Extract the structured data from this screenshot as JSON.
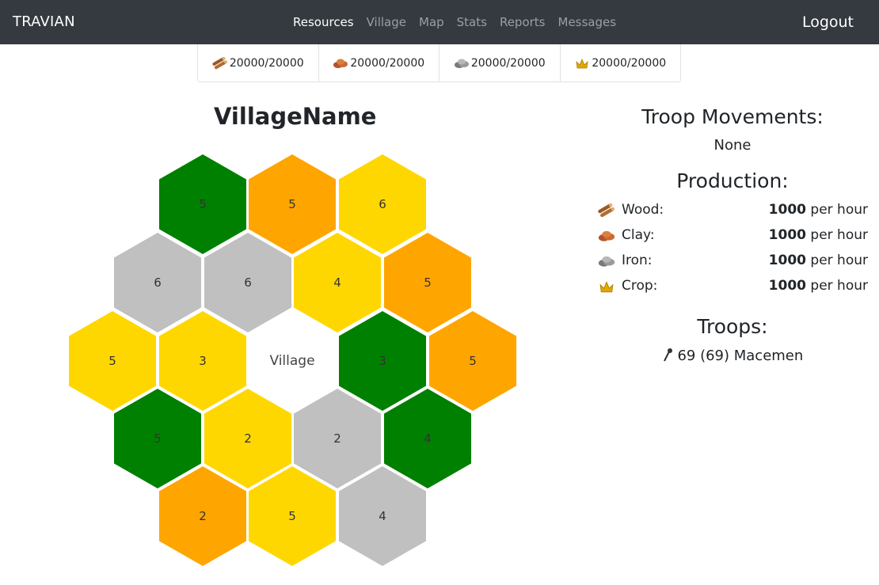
{
  "nav": {
    "brand": "TRAVIAN",
    "links": [
      "Resources",
      "Village",
      "Map",
      "Stats",
      "Reports",
      "Messages"
    ],
    "active": "Resources",
    "logout": "Logout"
  },
  "resources": [
    {
      "icon": "wood-icon",
      "value": "20000/20000"
    },
    {
      "icon": "clay-icon",
      "value": "20000/20000"
    },
    {
      "icon": "iron-icon",
      "value": "20000/20000"
    },
    {
      "icon": "crop-icon",
      "value": "20000/20000"
    }
  ],
  "village": {
    "name": "VillageName",
    "center_label": "Village",
    "fields": [
      {
        "color": "#008000",
        "level": "5"
      },
      {
        "color": "#FFA500",
        "level": "5"
      },
      {
        "color": "#FFD700",
        "level": "6"
      },
      {
        "color": "#C0C0C0",
        "level": "6"
      },
      {
        "color": "#C0C0C0",
        "level": "6"
      },
      {
        "color": "#FFD700",
        "level": "4"
      },
      {
        "color": "#FFA500",
        "level": "5"
      },
      {
        "color": "#FFD700",
        "level": "5"
      },
      {
        "color": "#FFD700",
        "level": "3"
      },
      {
        "color": "#008000",
        "level": "3"
      },
      {
        "color": "#FFA500",
        "level": "5"
      },
      {
        "color": "#008000",
        "level": "5"
      },
      {
        "color": "#FFD700",
        "level": "2"
      },
      {
        "color": "#C0C0C0",
        "level": "2"
      },
      {
        "color": "#008000",
        "level": "4"
      },
      {
        "color": "#FFA500",
        "level": "2"
      },
      {
        "color": "#FFD700",
        "level": "5"
      },
      {
        "color": "#C0C0C0",
        "level": "4"
      }
    ]
  },
  "troop_movements": {
    "heading": "Troop Movements:",
    "value": "None"
  },
  "production": {
    "heading": "Production:",
    "rows": [
      {
        "icon": "wood-icon",
        "label": "Wood:",
        "amount": "1000",
        "unit": "per hour"
      },
      {
        "icon": "clay-icon",
        "label": "Clay:",
        "amount": "1000",
        "unit": "per hour"
      },
      {
        "icon": "iron-icon",
        "label": "Iron:",
        "amount": "1000",
        "unit": "per hour"
      },
      {
        "icon": "crop-icon",
        "label": "Crop:",
        "amount": "1000",
        "unit": "per hour"
      }
    ]
  },
  "troops": {
    "heading": "Troops:",
    "list": [
      {
        "icon": "mace-icon",
        "text": "69 (69) Macemen"
      }
    ]
  }
}
